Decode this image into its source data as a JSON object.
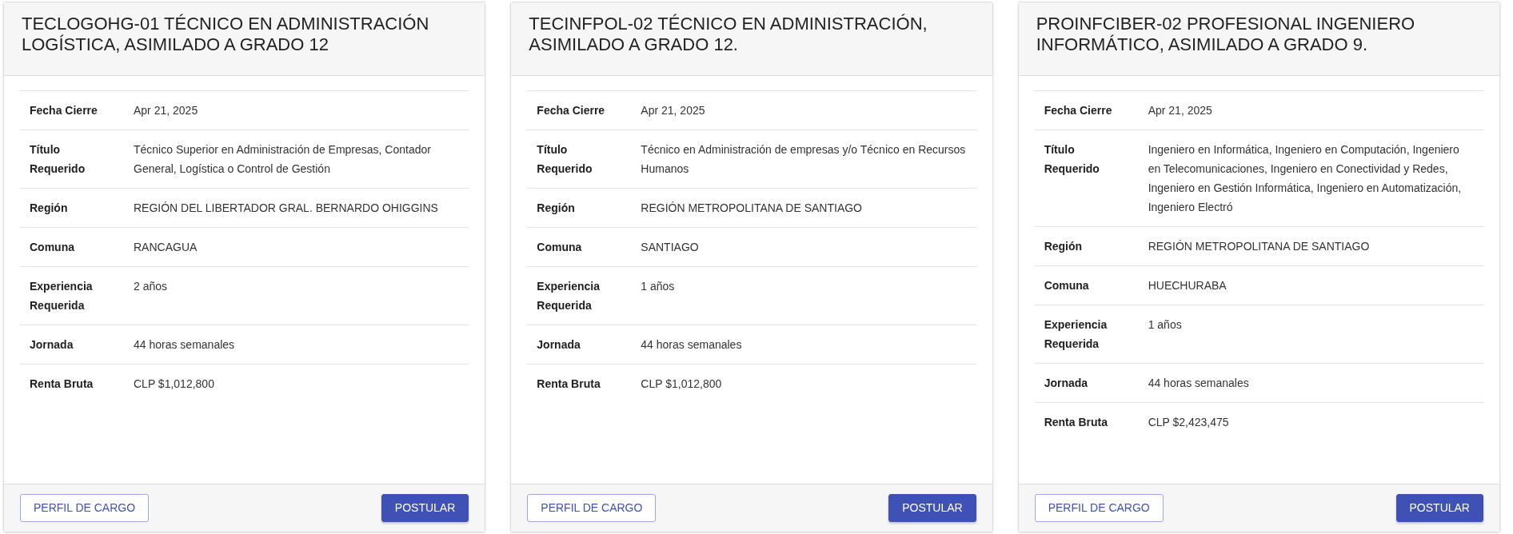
{
  "cards": [
    {
      "title": "TECLOGOHG-01 TÉCNICO EN ADMINISTRACIÓN LOGÍSTICA, ASIMILADO A GRADO 12",
      "rows": [
        {
          "label": "Fecha Cierre",
          "value": "Apr 21, 2025"
        },
        {
          "label": "Título Requerido",
          "value": "Técnico Superior en Administración de Empresas, Contador General, Logística o Control de Gestión"
        },
        {
          "label": "Región",
          "value": "REGIÓN DEL LIBERTADOR GRAL. BERNARDO OHIGGINS"
        },
        {
          "label": "Comuna",
          "value": "RANCAGUA"
        },
        {
          "label": "Experiencia Requerida",
          "value": "2 años"
        },
        {
          "label": "Jornada",
          "value": "44 horas semanales"
        },
        {
          "label": "Renta Bruta",
          "value": "CLP $1,012,800"
        }
      ],
      "buttons": [
        {
          "label": "PERFIL DE CARGO",
          "kind": "outline"
        },
        {
          "label": "POSTULAR",
          "kind": "primary"
        }
      ]
    },
    {
      "title": "TECINFPOL-02 TÉCNICO EN ADMINISTRACIÓN, ASIMILADO A GRADO 12.",
      "rows": [
        {
          "label": "Fecha Cierre",
          "value": "Apr 21, 2025"
        },
        {
          "label": "Título Requerido",
          "value": "Técnico en Administración de empresas y/o Técnico en Recursos Humanos"
        },
        {
          "label": "Región",
          "value": "REGIÓN METROPOLITANA DE SANTIAGO"
        },
        {
          "label": "Comuna",
          "value": "SANTIAGO"
        },
        {
          "label": "Experiencia Requerida",
          "value": "1 años"
        },
        {
          "label": "Jornada",
          "value": "44 horas semanales"
        },
        {
          "label": "Renta Bruta",
          "value": "CLP $1,012,800"
        }
      ],
      "buttons": [
        {
          "label": "PERFIL DE CARGO",
          "kind": "outline"
        },
        {
          "label": "POSTULAR",
          "kind": "primary"
        }
      ]
    },
    {
      "title": "PROINFCIBER-02 PROFESIONAL INGENIERO INFORMÁTICO, ASIMILADO A GRADO 9.",
      "rows": [
        {
          "label": "Fecha Cierre",
          "value": "Apr 21, 2025"
        },
        {
          "label": "Título Requerido",
          "value": "Ingeniero en Informática, Ingeniero en Computación, Ingeniero en Telecomunicaciones, Ingeniero en Conectividad y Redes, Ingeniero en Gestión Informática, Ingeniero en Automatización, Ingeniero Electró"
        },
        {
          "label": "Región",
          "value": "REGIÓN METROPOLITANA DE SANTIAGO"
        },
        {
          "label": "Comuna",
          "value": "HUECHURABA"
        },
        {
          "label": "Experiencia Requerida",
          "value": "1 años"
        },
        {
          "label": "Jornada",
          "value": "44 horas semanales"
        },
        {
          "label": "Renta Bruta",
          "value": "CLP $2,423,475"
        }
      ],
      "buttons": [
        {
          "label": "PERFIL DE CARGO",
          "kind": "outline"
        },
        {
          "label": "POSTULAR",
          "kind": "primary"
        }
      ]
    }
  ]
}
